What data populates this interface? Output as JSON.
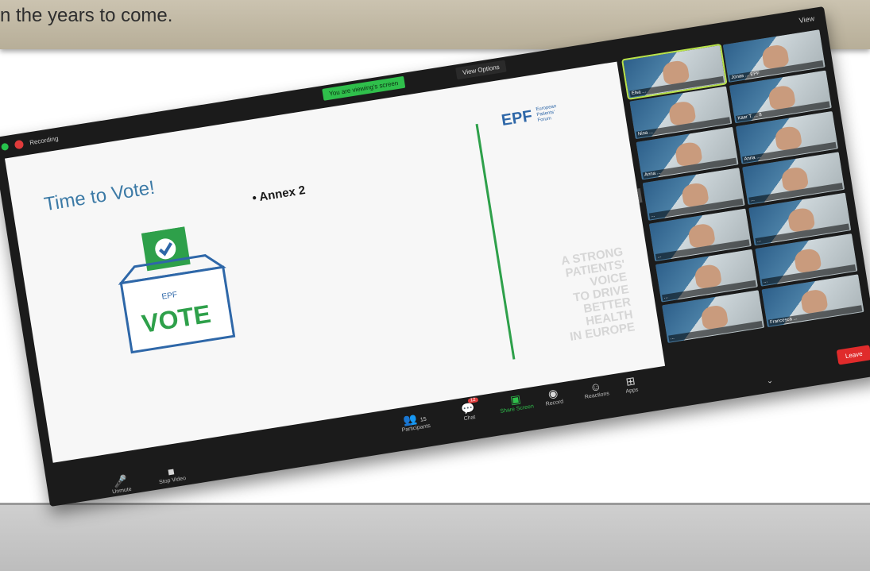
{
  "page": {
    "caption": "n the years to come."
  },
  "zoom": {
    "recording_label": "Recording",
    "view_label": "View",
    "share_banner": "You are viewing's screen",
    "view_options": "View Options",
    "slide": {
      "title": "Time to Vote!",
      "bullet": "Annex 2",
      "vote_text": "VOTE",
      "box_logo": "EPF",
      "logo_text": "EPF",
      "logo_subtitle": [
        "European",
        "Patients'",
        "Forum"
      ],
      "tagline": [
        "A STRONG",
        "PATIENTS'",
        "VOICE",
        "TO DRIVE",
        "BETTER",
        "HEALTH",
        "IN EUROPE"
      ]
    },
    "participants": [
      {
        "name": "Elsa ... ",
        "active": true
      },
      {
        "name": "Jonas ... EPF"
      },
      {
        "name": "Nina ... "
      },
      {
        "name": "Kaer T. ... 8"
      },
      {
        "name": "Anna ... "
      },
      {
        "name": "Anna ... "
      },
      {
        "name": "... "
      },
      {
        "name": "... "
      },
      {
        "name": "... "
      },
      {
        "name": "... "
      },
      {
        "name": "... "
      },
      {
        "name": "... "
      },
      {
        "name": "... "
      },
      {
        "name": "Francesca ... "
      }
    ],
    "controls": {
      "unmute": "Unmute",
      "stop_video": "Stop Video",
      "participants": "Participants",
      "participants_count": "15",
      "chat": "Chat",
      "chat_badge": "12",
      "share_screen": "Share Screen",
      "record": "Record",
      "reactions": "Reactions",
      "apps": "Apps",
      "leave": "Leave"
    },
    "colors": {
      "share_green": "#2fbf4b",
      "leave_red": "#e02b2b",
      "slide_blue": "#3c7aa6",
      "vote_blue": "#2e67a8"
    }
  }
}
